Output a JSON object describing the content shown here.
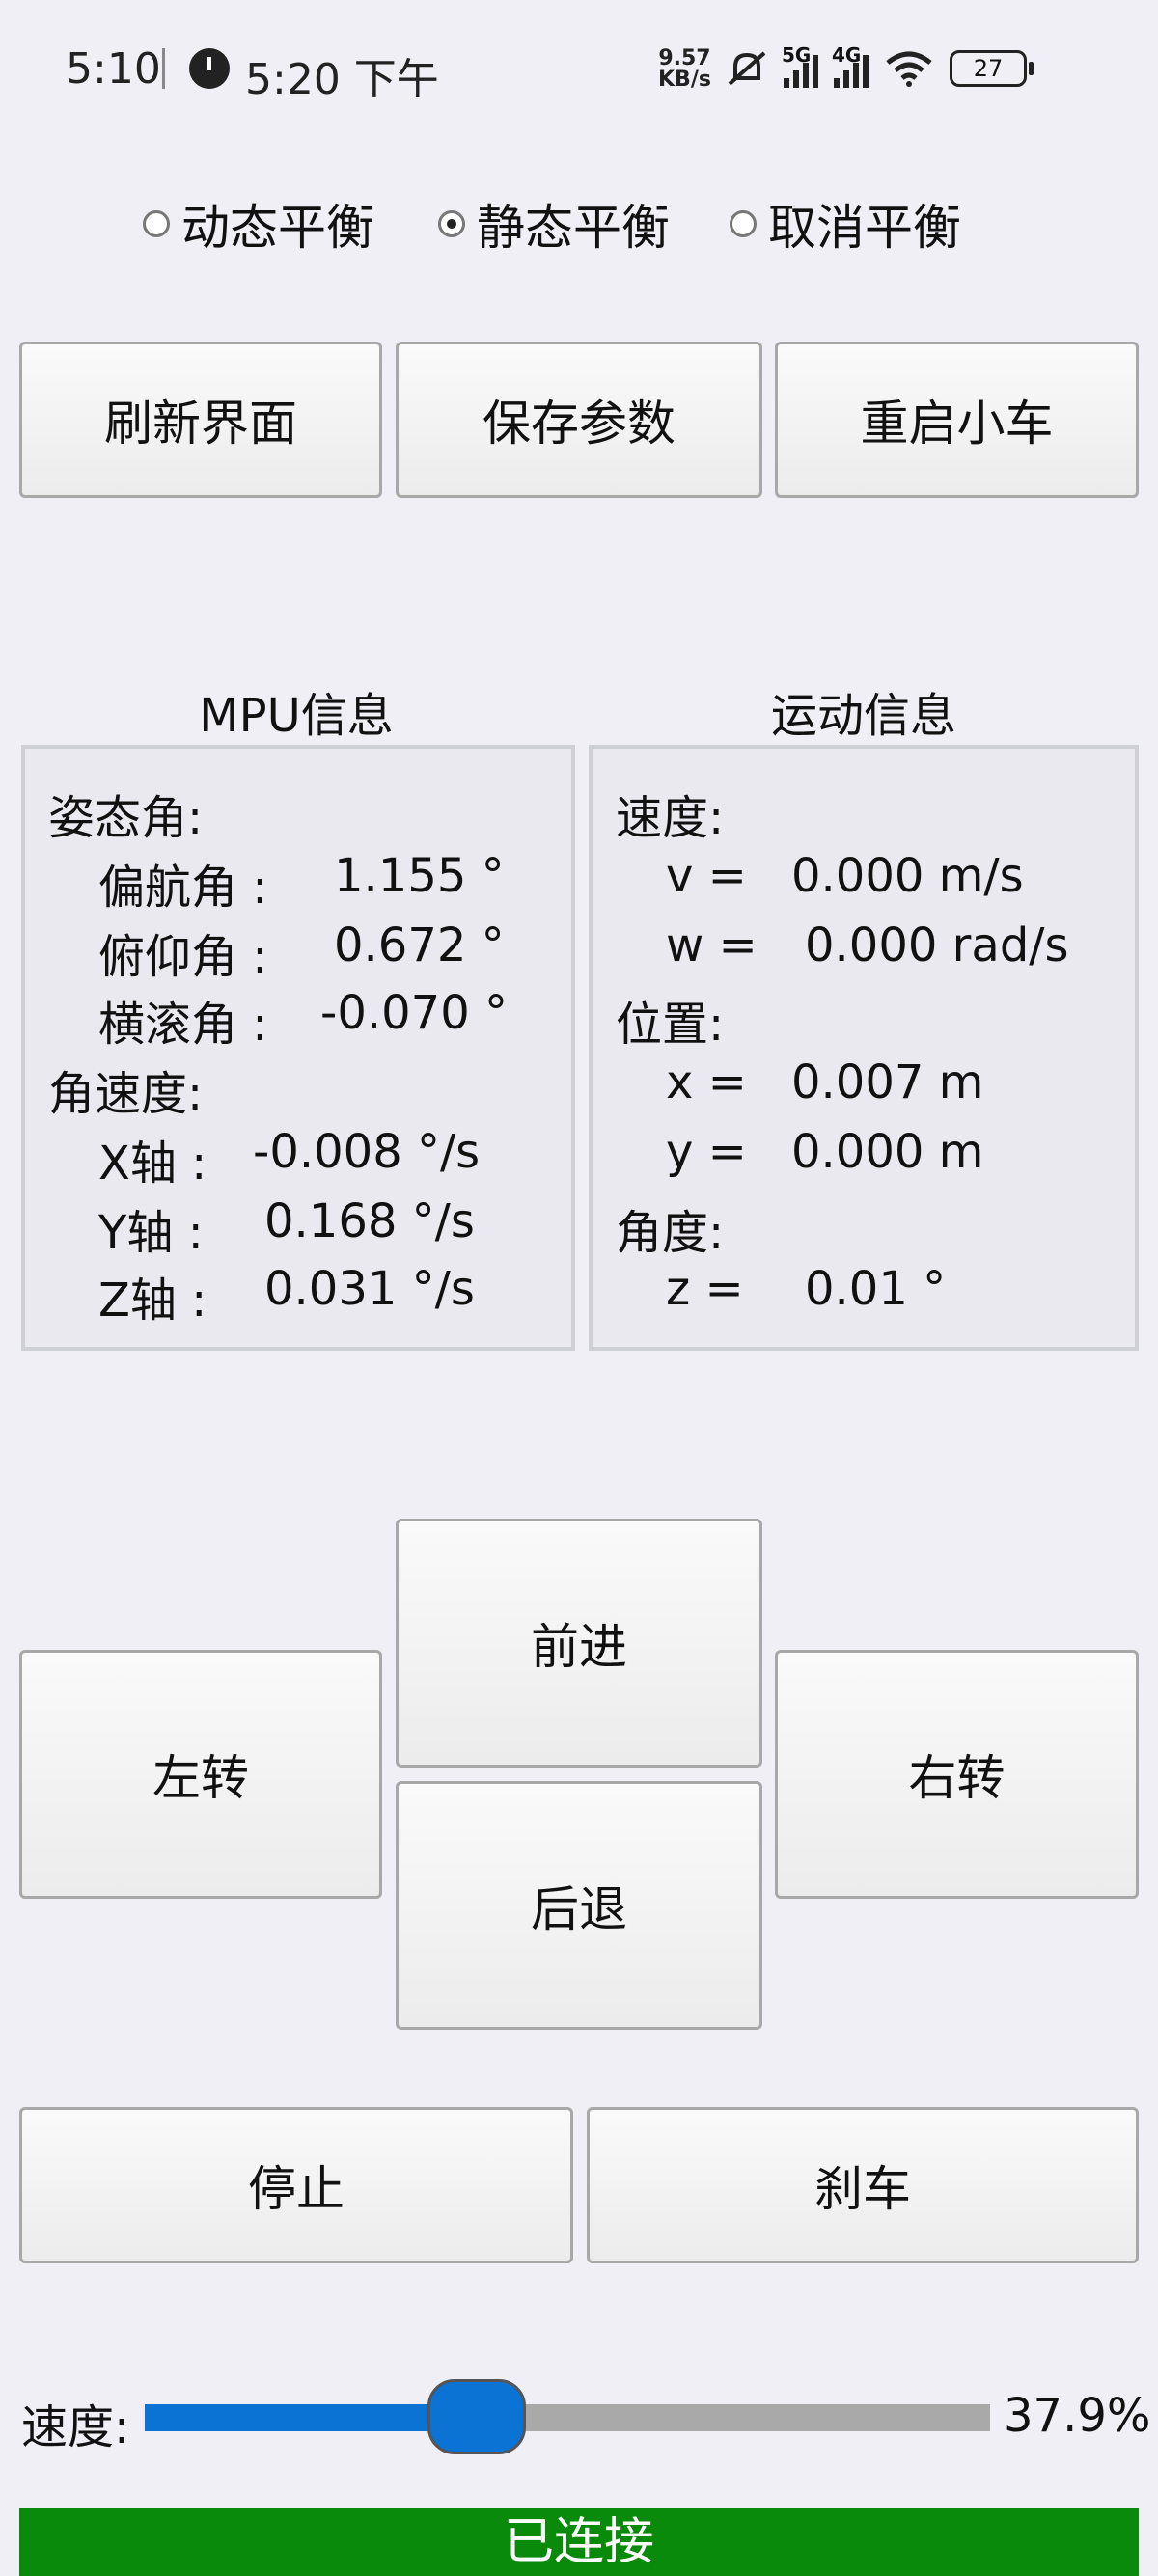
{
  "status_bar": {
    "time": "5:10",
    "clock_time": "5:20 下午",
    "net_rate": "9.57",
    "net_unit": "KB/s",
    "sig1_label": "5G",
    "sig2_label": "4G",
    "battery": "27"
  },
  "balance_mode": {
    "options": [
      "动态平衡",
      "静态平衡",
      "取消平衡"
    ],
    "selected": "静态平衡"
  },
  "top_buttons": {
    "refresh": "刷新界面",
    "save": "保存参数",
    "restart": "重启小车"
  },
  "mpu": {
    "title": "MPU信息",
    "attitude_label": "姿态角:",
    "yaw_label": "偏航角 :",
    "yaw_value": "1.155 °",
    "pitch_label": "俯仰角 :",
    "pitch_value": "0.672 °",
    "roll_label": "横滚角 :",
    "roll_value": "-0.070 °",
    "angvel_label": "角速度:",
    "x_label": "X轴 :",
    "x_value": "-0.008 °/s",
    "y_label": "Y轴 :",
    "y_value": "0.168 °/s",
    "z_label": "Z轴 :",
    "z_value": "0.031 °/s"
  },
  "motion": {
    "title": "运动信息",
    "speed_label": "速度:",
    "v_label": "v =",
    "v_value": "0.000 m/s",
    "w_label": "w =",
    "w_value": "0.000 rad/s",
    "position_label": "位置:",
    "x_label": "x =",
    "x_value": "0.007 m",
    "y_label": "y =",
    "y_value": "0.000 m",
    "angle_label": "角度:",
    "z_label": "z =",
    "z_value": "0.01 °"
  },
  "drive": {
    "forward": "前进",
    "left": "左转",
    "right": "右转",
    "backward": "后退",
    "stop": "停止",
    "brake": "刹车"
  },
  "speed": {
    "label": "速度:",
    "value_text": "37.9%",
    "fraction": 0.379
  },
  "connection": {
    "status": "已连接"
  }
}
